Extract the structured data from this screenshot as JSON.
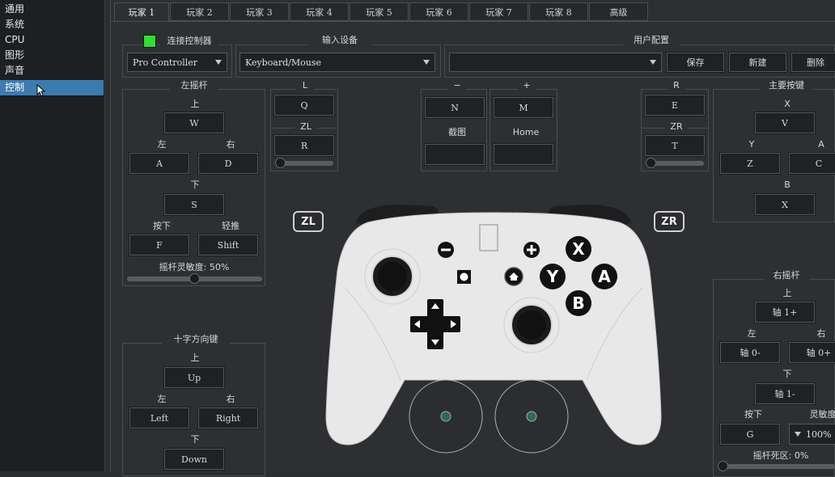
{
  "sidebar": {
    "items": [
      {
        "label": "通用"
      },
      {
        "label": "系统"
      },
      {
        "label": "CPU"
      },
      {
        "label": "图形"
      },
      {
        "label": "声音"
      },
      {
        "label": "控制"
      }
    ],
    "selected_index": 5
  },
  "tabs": [
    {
      "label": "玩家 1"
    },
    {
      "label": "玩家 2"
    },
    {
      "label": "玩家 3"
    },
    {
      "label": "玩家 4"
    },
    {
      "label": "玩家 5"
    },
    {
      "label": "玩家 6"
    },
    {
      "label": "玩家 7"
    },
    {
      "label": "玩家 8"
    },
    {
      "label": "高级"
    }
  ],
  "connect": {
    "label": "连接控制器",
    "controller_type": "Pro Controller",
    "status_color": "#33dd33"
  },
  "input_device": {
    "title": "输入设备",
    "value": "Keyboard/Mouse"
  },
  "user_config": {
    "title": "用户配置",
    "value": "",
    "save": "保存",
    "new": "新建",
    "delete": "删除"
  },
  "left_stick": {
    "title": "左摇杆",
    "up_label": "上",
    "up": "W",
    "left_label": "左",
    "left": "A",
    "right_label": "右",
    "right": "D",
    "down_label": "下",
    "down": "S",
    "press_label": "按下",
    "press": "F",
    "light_label": "轻推",
    "light": "Shift",
    "sensitivity_label": "摇杆灵敏度: 50%",
    "sensitivity_value": 0.5
  },
  "l_group": {
    "l_label": "L",
    "l": "Q",
    "zl_label": "ZL",
    "zl": "R",
    "slider_value": 0.0
  },
  "minus_plus": {
    "minus_label": "−",
    "minus": "N",
    "plus_label": "+",
    "plus": "M",
    "capture_label": "截图",
    "capture": "",
    "home_label": "Home",
    "home": ""
  },
  "r_group": {
    "r_label": "R",
    "r": "E",
    "zr_label": "ZR",
    "zr": "T",
    "slider_value": 0.0
  },
  "face_buttons": {
    "title": "主要按键",
    "x_label": "X",
    "x": "V",
    "y_label": "Y",
    "y": "Z",
    "a_label": "A",
    "a": "C",
    "b_label": "B",
    "b": "X"
  },
  "dpad": {
    "title": "十字方向键",
    "up_label": "上",
    "up": "Up",
    "left_label": "左",
    "left": "Left",
    "right_label": "右",
    "right": "Right",
    "down_label": "下",
    "down": "Down"
  },
  "right_stick": {
    "title": "右摇杆",
    "up_label": "上",
    "up": "轴 1+",
    "left_label": "左",
    "left": "轴 0-",
    "right_label": "右",
    "right": "轴 0+",
    "down_label": "下",
    "down": "轴 1-",
    "press_label": "按下",
    "press": "G",
    "sensitivity_label": "灵敏度",
    "sensitivity": "100%",
    "deadzone_label": "摇杆死区: 0%",
    "deadzone_value": 0.0
  },
  "controller": {
    "zl": "ZL",
    "zr": "ZR",
    "x": "X",
    "y": "Y",
    "a": "A",
    "b": "B",
    "minus": "−",
    "plus": "+"
  }
}
